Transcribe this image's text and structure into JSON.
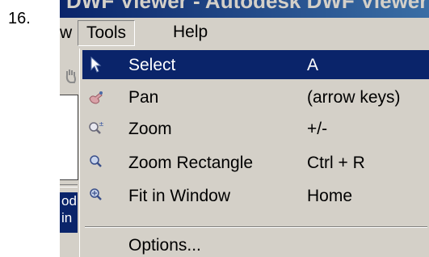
{
  "step_number": "16.",
  "window": {
    "title": "DWF Viewer - Autodesk DWF Viewer"
  },
  "menubar": {
    "prev_menu_fragment": "w",
    "tools": "Tools",
    "help": "Help"
  },
  "background": {
    "blue_panel_lines": [
      "od",
      "in"
    ]
  },
  "tools_menu": {
    "items": [
      {
        "label": "Select",
        "shortcut": "A",
        "icon": "pointer-arrow-icon",
        "highlighted": true
      },
      {
        "label": "Pan",
        "shortcut": "(arrow keys)",
        "icon": "hand-pan-icon"
      },
      {
        "label": "Zoom",
        "shortcut": "+/-",
        "icon": "zoom-icon"
      },
      {
        "label": "Zoom Rectangle",
        "shortcut": "Ctrl + R",
        "icon": "zoom-rectangle-icon"
      },
      {
        "label": "Fit in Window",
        "shortcut": "Home",
        "icon": "fit-window-icon"
      }
    ],
    "options": {
      "label": "Options..."
    }
  },
  "colors": {
    "menu_bg": "#d4d0c8",
    "highlight": "#0a246a",
    "highlight_text": "#ffffff"
  }
}
